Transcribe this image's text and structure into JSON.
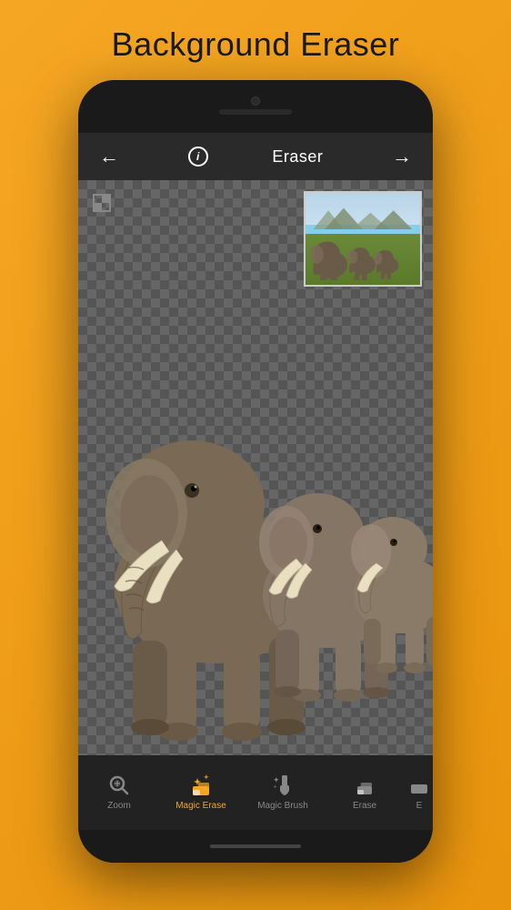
{
  "page": {
    "title": "Background Eraser",
    "background_color": "#f5a623"
  },
  "header": {
    "title": "Eraser",
    "back_label": "←",
    "forward_label": "→",
    "info_label": "i"
  },
  "toolbar": {
    "split_view_label": "split-view",
    "undo_label": "↩",
    "redo_label": "↪"
  },
  "tabs": [
    {
      "id": "zoom",
      "label": "Zoom",
      "icon": "zoom-icon",
      "active": false
    },
    {
      "id": "magic-erase",
      "label": "Magic Erase",
      "icon": "magic-erase-icon",
      "active": true
    },
    {
      "id": "magic-brush",
      "label": "Magic Brush",
      "icon": "magic-brush-icon",
      "active": false
    },
    {
      "id": "erase",
      "label": "Erase",
      "icon": "erase-icon",
      "active": false
    },
    {
      "id": "extra",
      "label": "E",
      "icon": "extra-icon",
      "active": false
    }
  ],
  "canvas": {
    "background": "checkered",
    "thumbnail": {
      "visible": true,
      "position": "top-right"
    }
  }
}
